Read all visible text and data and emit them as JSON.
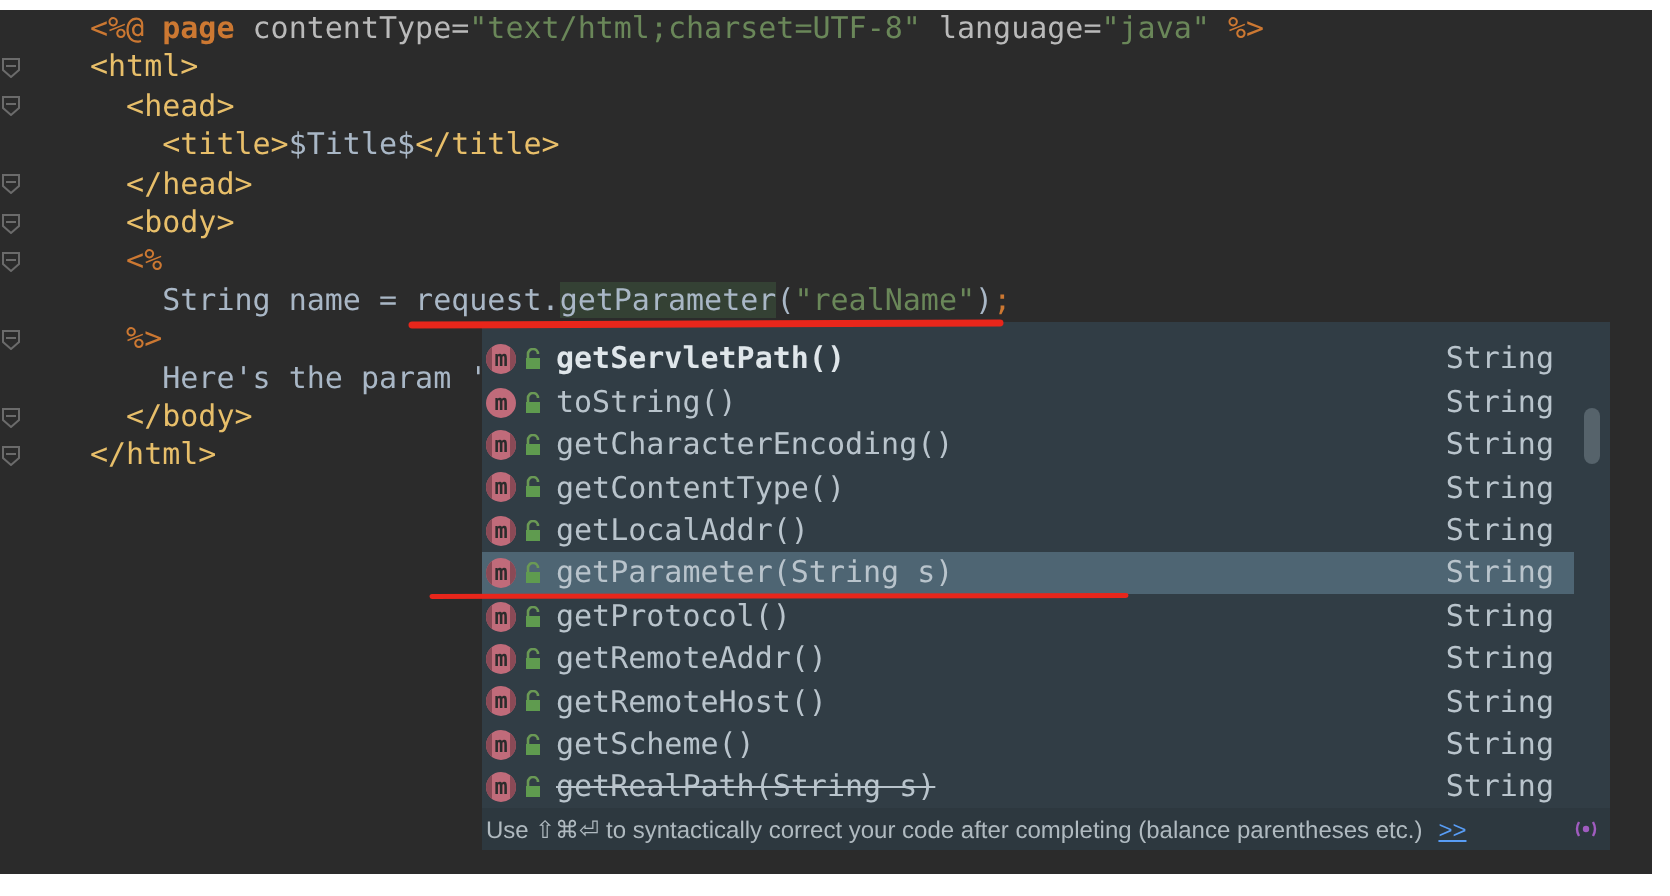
{
  "editor": {
    "lines": [
      {
        "fold": false,
        "tokens": [
          {
            "kind": "scriptlet",
            "text": "<%@ "
          },
          {
            "kind": "keyword",
            "text": "page"
          },
          {
            "kind": "attr",
            "text": " contentType="
          },
          {
            "kind": "string",
            "text": "\"text/html;charset=UTF-8\""
          },
          {
            "kind": "attr",
            "text": " language="
          },
          {
            "kind": "string",
            "text": "\"java\""
          },
          {
            "kind": "scriptlet",
            "text": " %>"
          }
        ]
      },
      {
        "fold": true,
        "tokens": [
          {
            "kind": "tag",
            "text": "<html>"
          }
        ]
      },
      {
        "fold": true,
        "tokens": [
          {
            "kind": "tag",
            "text": "  <head>"
          }
        ]
      },
      {
        "fold": false,
        "tokens": [
          {
            "kind": "tag",
            "text": "    <title>"
          },
          {
            "kind": "text",
            "text": "$Title$"
          },
          {
            "kind": "tag",
            "text": "</title>"
          }
        ]
      },
      {
        "fold": true,
        "tokens": [
          {
            "kind": "tag",
            "text": "  </head>"
          }
        ]
      },
      {
        "fold": true,
        "tokens": [
          {
            "kind": "tag",
            "text": "  <body>"
          }
        ]
      },
      {
        "fold": true,
        "tokens": [
          {
            "kind": "scriptlet",
            "text": "  <%"
          }
        ]
      },
      {
        "fold": false,
        "tokens": [
          {
            "kind": "text",
            "text": "    String name = request."
          },
          {
            "kind": "match",
            "text": "getParameter"
          },
          {
            "kind": "text",
            "text": "("
          },
          {
            "kind": "string",
            "text": "\"realName\""
          },
          {
            "kind": "text",
            "text": ")"
          },
          {
            "kind": "scriptlet",
            "text": ";"
          }
        ]
      },
      {
        "fold": true,
        "tokens": [
          {
            "kind": "scriptlet",
            "text": "  %>"
          }
        ]
      },
      {
        "fold": false,
        "tokens": [
          {
            "kind": "text",
            "text": "    Here's the param '"
          }
        ]
      },
      {
        "fold": true,
        "tokens": [
          {
            "kind": "tag",
            "text": "  </body>"
          }
        ]
      },
      {
        "fold": true,
        "tokens": [
          {
            "kind": "tag",
            "text": "</html>"
          }
        ]
      }
    ]
  },
  "completion": {
    "items": [
      {
        "kind": "interface_method",
        "icon": "m",
        "name": "getServletPath()",
        "type": "String",
        "bold": true,
        "deprecated": false,
        "selected": false
      },
      {
        "kind": "method",
        "icon": "m",
        "name": "toString()",
        "type": "String",
        "bold": false,
        "deprecated": false,
        "selected": false
      },
      {
        "kind": "interface_method",
        "icon": "m",
        "name": "getCharacterEncoding()",
        "type": "String",
        "bold": false,
        "deprecated": false,
        "selected": false
      },
      {
        "kind": "interface_method",
        "icon": "m",
        "name": "getContentType()",
        "type": "String",
        "bold": false,
        "deprecated": false,
        "selected": false
      },
      {
        "kind": "interface_method",
        "icon": "m",
        "name": "getLocalAddr()",
        "type": "String",
        "bold": false,
        "deprecated": false,
        "selected": false
      },
      {
        "kind": "interface_method",
        "icon": "m",
        "name": "getParameter(String s)",
        "type": "String",
        "bold": false,
        "deprecated": false,
        "selected": true
      },
      {
        "kind": "interface_method",
        "icon": "m",
        "name": "getProtocol()",
        "type": "String",
        "bold": false,
        "deprecated": false,
        "selected": false
      },
      {
        "kind": "interface_method",
        "icon": "m",
        "name": "getRemoteAddr()",
        "type": "String",
        "bold": false,
        "deprecated": false,
        "selected": false
      },
      {
        "kind": "interface_method",
        "icon": "m",
        "name": "getRemoteHost()",
        "type": "String",
        "bold": false,
        "deprecated": false,
        "selected": false
      },
      {
        "kind": "interface_method",
        "icon": "m",
        "name": "getScheme()",
        "type": "String",
        "bold": false,
        "deprecated": false,
        "selected": false
      },
      {
        "kind": "interface_method",
        "icon": "m",
        "name": "getRealPath(String s)",
        "type": "String",
        "bold": false,
        "deprecated": true,
        "selected": false
      }
    ],
    "hint": "Use ⇧⌘⏎ to syntactically correct your code after completing (balance parentheses etc.)",
    "hint_link": ">>"
  }
}
